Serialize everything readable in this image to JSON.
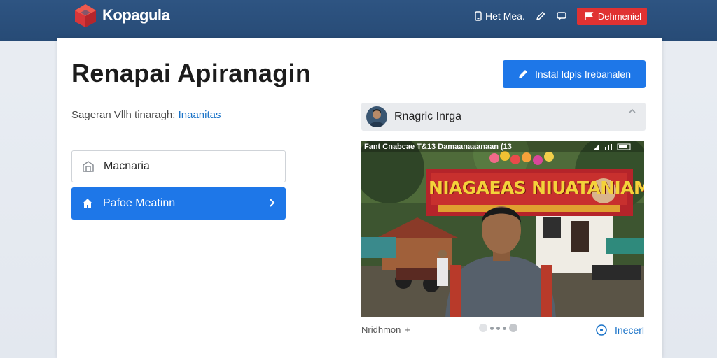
{
  "brand": {
    "name": "Kopagula"
  },
  "nav": {
    "link_label": "Het Mea.",
    "cta_label": "Dehmeniel"
  },
  "main": {
    "title": "Renapai Apiranagin",
    "subtitle_prefix": "Sageran Vllh tinaragh:",
    "subtitle_link": "Inaanitas",
    "buttons": [
      {
        "label": "Macnaria"
      },
      {
        "label": "Pafoe Meatinn"
      }
    ],
    "install_label": "Instal Idpls Irebanalen"
  },
  "user": {
    "name": "Rnagric Inrga"
  },
  "photo": {
    "status_text": "Fant Cnabcae T&13 Damaanaaanaan (13",
    "banner_text": "NIAGAEAS NIUATANIAMAGA"
  },
  "footer": {
    "caption": "Nridhmon",
    "caption_plus": "+",
    "report_label": "Inecerl"
  },
  "colors": {
    "topbar": "#2e5482",
    "primary": "#1e77e8",
    "cta_red": "#e03232",
    "link": "#1a73c8"
  }
}
